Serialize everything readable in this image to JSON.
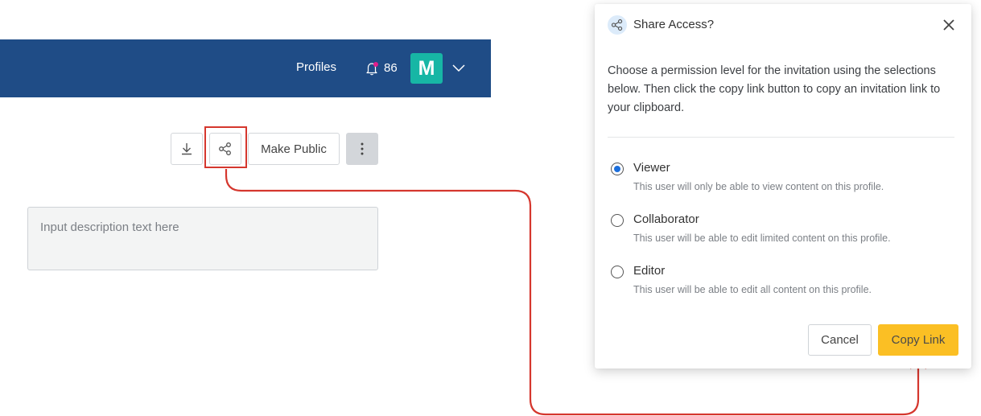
{
  "header": {
    "nav_profiles": "Profiles",
    "notification_count": "86",
    "avatar_initial": "M",
    "colors": {
      "background": "#1f4c86",
      "avatar": "#17b6a5",
      "notification_dot": "#e21d8b"
    }
  },
  "toolbar": {
    "download_icon": "download-icon",
    "share_icon": "share-icon",
    "make_public_label": "Make Public",
    "more_icon": "more-vertical-icon"
  },
  "description": {
    "placeholder": "Input description text here",
    "value": ""
  },
  "modal": {
    "icon": "share-icon",
    "title": "Share Access?",
    "close_icon": "close-icon",
    "description": "Choose a permission level for the invitation using the selections below. Then click the copy link button to copy an invitation link to your clipboard.",
    "selected_option": "Viewer",
    "options": [
      {
        "label": "Viewer",
        "help": "This user will only be able to view content on this profile.",
        "checked": true
      },
      {
        "label": "Collaborator",
        "help": "This user will be able to edit limited content on this profile.",
        "checked": false
      },
      {
        "label": "Editor",
        "help": "This user will be able to edit all content on this profile.",
        "checked": false
      }
    ],
    "cancel_label": "Cancel",
    "copy_link_label": "Copy Link",
    "colors": {
      "primary_button": "#fbbf24",
      "radio_selected": "#1c6fdc"
    }
  },
  "annotation": {
    "color": "#d5372e",
    "description": "Arrow connecting share button to Copy Link button"
  }
}
